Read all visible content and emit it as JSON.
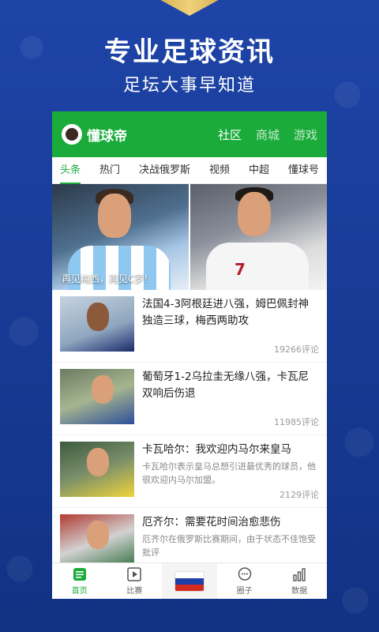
{
  "promo": {
    "headline": "专业足球资讯",
    "subline": "足坛大事早知道"
  },
  "app": {
    "logo_text": "懂球帝",
    "top_tabs": [
      {
        "label": "社区",
        "active": true
      },
      {
        "label": "商城",
        "active": false
      },
      {
        "label": "游戏",
        "active": false
      }
    ],
    "categories": [
      {
        "label": "头条",
        "active": true
      },
      {
        "label": "热门",
        "active": false
      },
      {
        "label": "决战俄罗斯",
        "active": false
      },
      {
        "label": "视频",
        "active": false
      },
      {
        "label": "中超",
        "active": false
      },
      {
        "label": "懂球号",
        "active": false
      }
    ],
    "banner_caption": "再见梅西，再见C罗!",
    "news": [
      {
        "title": "法国4-3阿根廷进八强，姆巴佩封神独造三球，梅西两助攻",
        "desc": "",
        "comments": "19266评论"
      },
      {
        "title": "葡萄牙1-2乌拉圭无缘八强，卡瓦尼双响后伤退",
        "desc": "",
        "comments": "11985评论"
      },
      {
        "title": "卡瓦哈尔：我欢迎内马尔来皇马",
        "desc": "卡瓦哈尔表示皇马总想引进最优秀的球员，他很欢迎内马尔加盟。",
        "comments": "2129评论"
      },
      {
        "title": "厄齐尔：需要花时间治愈悲伤",
        "desc": "厄齐尔在俄罗斯比赛期间，由于状态不佳饱受批评",
        "comments": ""
      }
    ],
    "bottom_nav": [
      {
        "label": "首页",
        "icon": "home-icon",
        "active": true
      },
      {
        "label": "比赛",
        "icon": "play-icon",
        "active": false
      },
      {
        "label": "",
        "icon": "russia-flag-icon",
        "active": false
      },
      {
        "label": "圈子",
        "icon": "chat-icon",
        "active": false
      },
      {
        "label": "数据",
        "icon": "bar-chart-icon",
        "active": false
      }
    ],
    "colors": {
      "brand_green": "#1aab3b",
      "background_blue": "#1a3c9c"
    }
  }
}
